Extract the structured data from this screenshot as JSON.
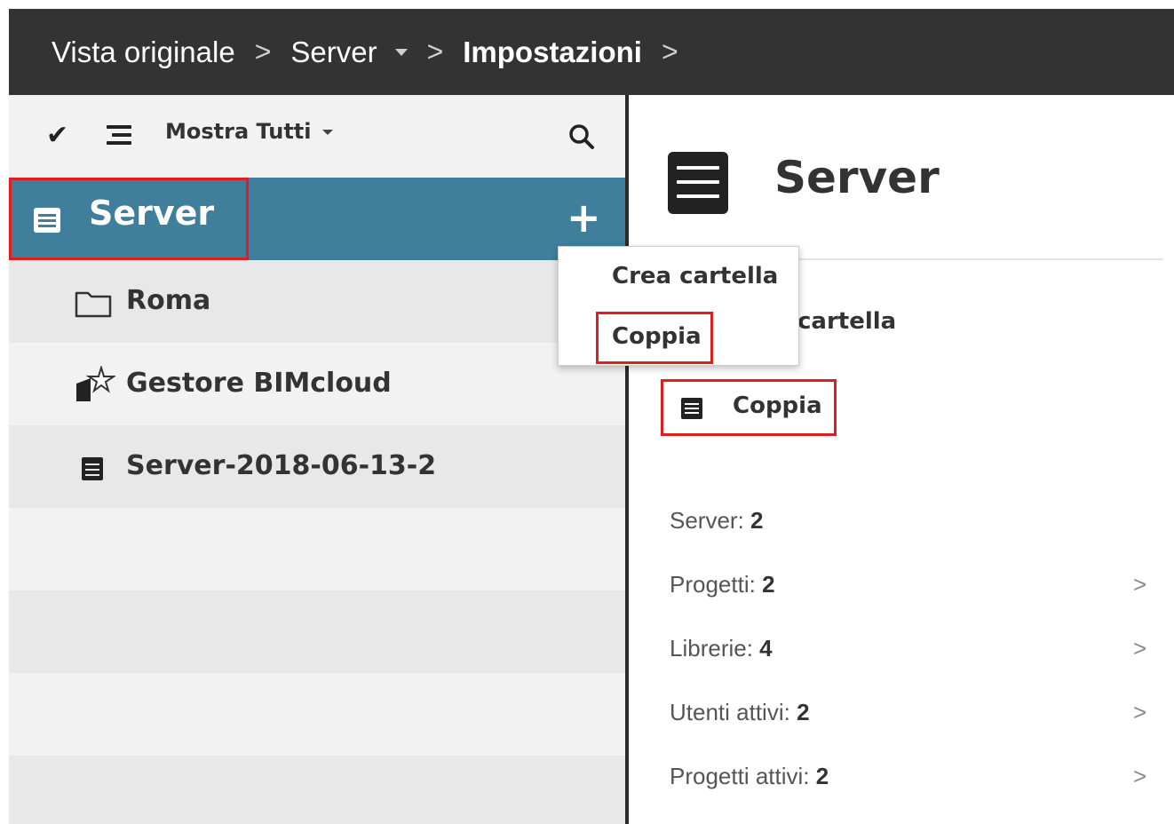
{
  "breadcrumb": {
    "items": [
      {
        "label": "Vista originale"
      },
      {
        "label": "Server"
      },
      {
        "label": "Impostazioni"
      }
    ],
    "separator": ">"
  },
  "toolbar": {
    "check_icon": "checkmark-icon",
    "list_icon": "list-icon",
    "filter_label": "Mostra Tutti",
    "search_icon": "search-icon"
  },
  "tree": {
    "selected": {
      "label": "Server",
      "icon": "server-icon",
      "add_icon": "plus-icon"
    },
    "items": [
      {
        "label": "Roma",
        "icon": "folder-icon"
      },
      {
        "label": "Gestore BIMcloud",
        "icon": "manager-star-icon"
      },
      {
        "label": "Server-2018-06-13-2",
        "icon": "server-icon"
      }
    ]
  },
  "context_menu": {
    "items": [
      {
        "label": "Crea cartella"
      },
      {
        "label": "Coppia"
      }
    ]
  },
  "detail": {
    "title": "Server",
    "partial_label": "cartella",
    "pair_button": "Coppia",
    "stats": [
      {
        "label": "Server:",
        "value": "2",
        "chevron": false
      },
      {
        "label": "Progetti:",
        "value": "2",
        "chevron": true
      },
      {
        "label": "Librerie:",
        "value": "4",
        "chevron": true
      },
      {
        "label": "Utenti attivi:",
        "value": "2",
        "chevron": true
      },
      {
        "label": "Progetti attivi:",
        "value": "2",
        "chevron": true
      }
    ],
    "chevron_glyph": ">"
  },
  "colors": {
    "topbar": "#333333",
    "selected_row": "#3f7f9c",
    "highlight": "#e01e1e"
  }
}
